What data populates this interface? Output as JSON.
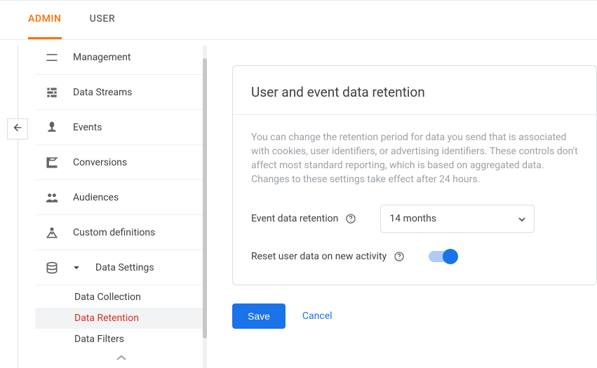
{
  "tabs": {
    "admin": "ADMIN",
    "user": "USER"
  },
  "sidebar": {
    "management": "Management",
    "data_streams": "Data Streams",
    "events": "Events",
    "conversions": "Conversions",
    "audiences": "Audiences",
    "custom_definitions": "Custom definitions",
    "data_settings": {
      "label": "Data Settings",
      "items": {
        "collection": "Data Collection",
        "retention": "Data Retention",
        "filters": "Data Filters"
      }
    }
  },
  "card": {
    "title": "User and event data retention",
    "description": "You can change the retention period for data you send that is associated with cookies, user identifiers, or advertising identifiers. These controls don't affect most standard reporting, which is based on aggregated data. Changes to these settings take effect after 24 hours.",
    "event_label": "Event data retention",
    "event_value": "14 months",
    "reset_label": "Reset user data on new activity",
    "reset_value": true
  },
  "actions": {
    "save": "Save",
    "cancel": "Cancel"
  }
}
